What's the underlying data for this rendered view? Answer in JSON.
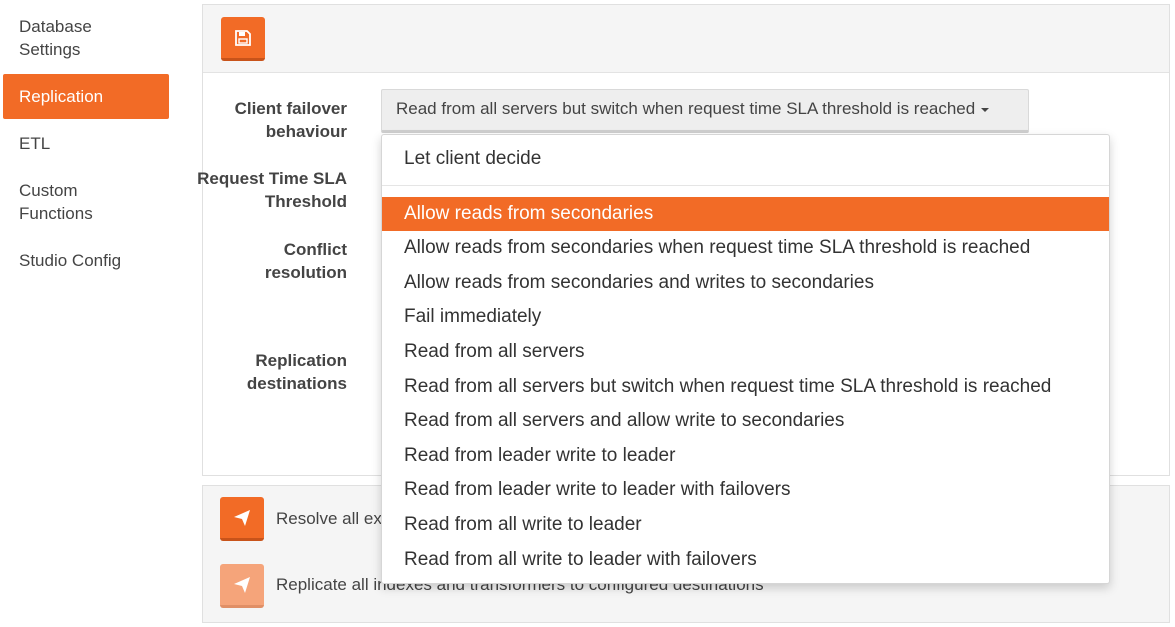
{
  "sidebar": {
    "items": [
      {
        "label": "Database\nSettings"
      },
      {
        "label": "Replication"
      },
      {
        "label": "ETL"
      },
      {
        "label": "Custom\nFunctions"
      },
      {
        "label": "Studio Config"
      }
    ]
  },
  "form": {
    "failover_label": "Client failover behaviour",
    "sla_label": "Request Time SLA Threshold",
    "conflict_label": "Conflict resolution",
    "destinations_label": "Replication destinations",
    "failover_selected": "Read from all servers but switch when request time SLA threshold is reached"
  },
  "dropdown": {
    "first": "Let client decide",
    "options": [
      "Allow reads from secondaries",
      "Allow reads from secondaries when request time SLA threshold is reached",
      "Allow reads from secondaries and writes to secondaries",
      "Fail immediately",
      "Read from all servers",
      "Read from all servers but switch when request time SLA threshold is reached",
      "Read from all servers and allow write to secondaries",
      "Read from leader write to leader",
      "Read from leader write to leader with failovers",
      "Read from all write to leader",
      "Read from all write to leader with failovers"
    ]
  },
  "actions": {
    "resolve": "Resolve all ex",
    "replicate": "Replicate all indexes and transformers to configured destinations"
  },
  "colors": {
    "accent": "#f26b26"
  }
}
